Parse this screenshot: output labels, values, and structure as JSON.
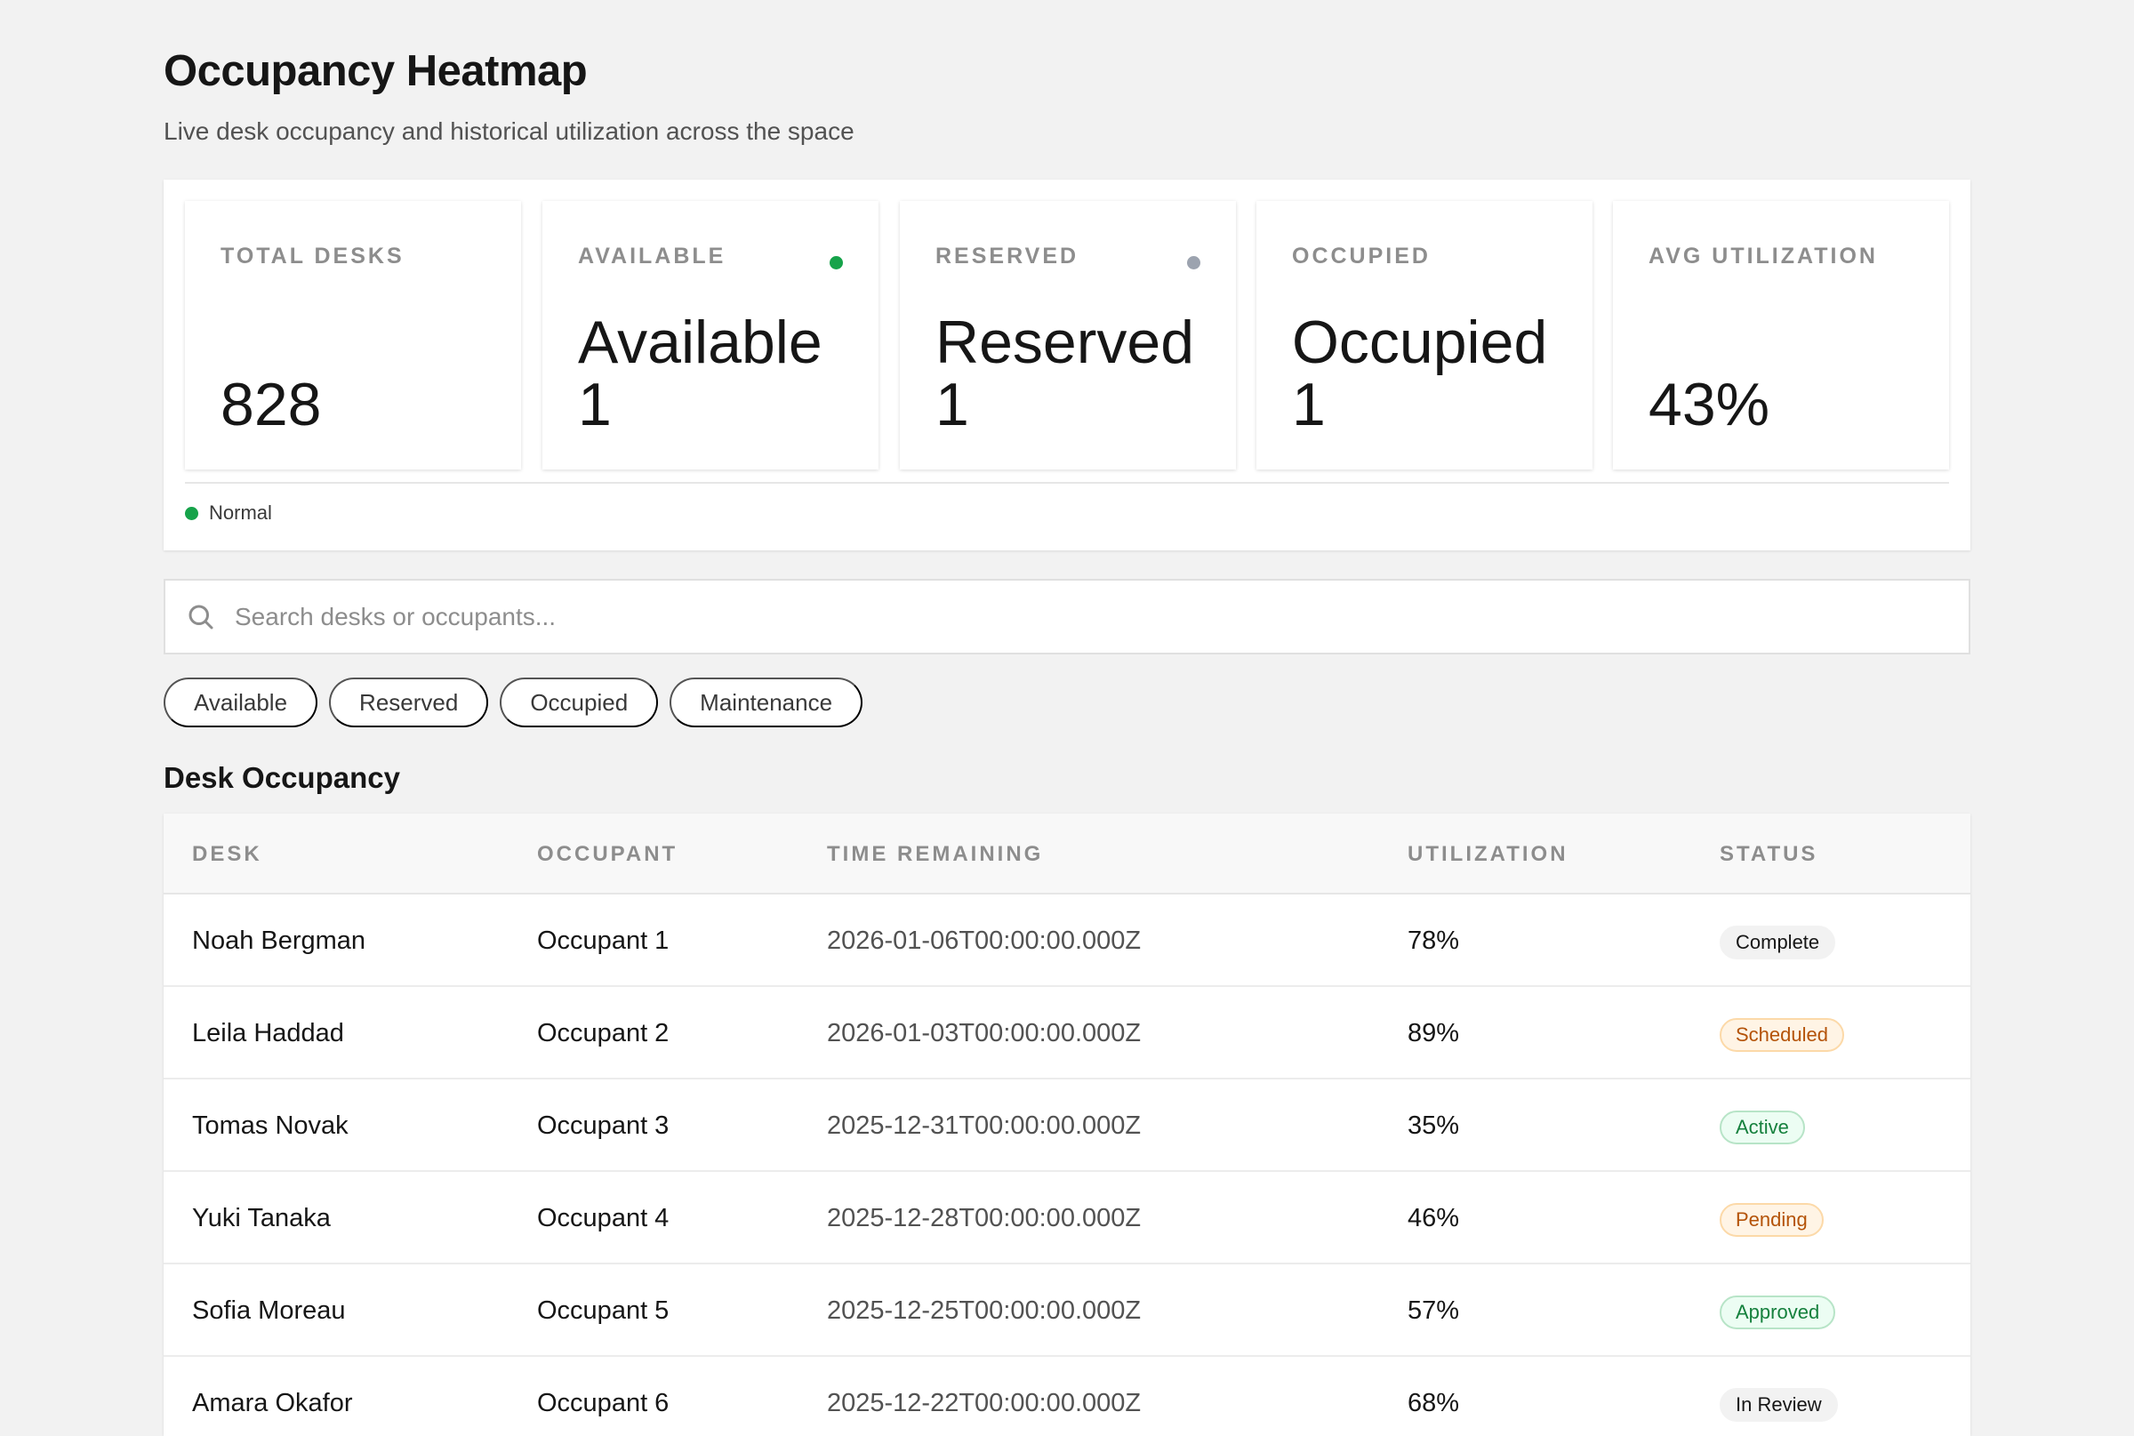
{
  "header": {
    "title": "Occupancy Heatmap",
    "subtitle": "Live desk occupancy and historical utilization across the space"
  },
  "stats": [
    {
      "label": "TOTAL DESKS",
      "value_top": "",
      "value_bottom": "828",
      "dot_color": ""
    },
    {
      "label": "AVAILABLE",
      "value_top": "Available",
      "value_bottom": "1",
      "dot_color": "#16a34a"
    },
    {
      "label": "RESERVED",
      "value_top": "Reserved",
      "value_bottom": "1",
      "dot_color": "#9ca3af"
    },
    {
      "label": "OCCUPIED",
      "value_top": "Occupied",
      "value_bottom": "1",
      "dot_color": ""
    },
    {
      "label": "AVG UTILIZATION",
      "value_top": "",
      "value_bottom": "43%",
      "dot_color": ""
    }
  ],
  "legend": {
    "label": "Normal",
    "dot_color": "#16a34a"
  },
  "search": {
    "placeholder": "Search desks or occupants...",
    "value": ""
  },
  "filters": [
    "Available",
    "Reserved",
    "Occupied",
    "Maintenance"
  ],
  "table": {
    "title": "Desk Occupancy",
    "columns": [
      "DESK",
      "OCCUPANT",
      "TIME REMAINING",
      "UTILIZATION",
      "STATUS"
    ],
    "rows": [
      {
        "desk": "Noah Bergman",
        "occupant": "Occupant 1",
        "time": "2026-01-06T00:00:00.000Z",
        "util": "78%",
        "status": "Complete",
        "badge": {
          "bg": "#f2f2f2",
          "fg": "#161616",
          "border": "#f2f2f2"
        }
      },
      {
        "desk": "Leila Haddad",
        "occupant": "Occupant 2",
        "time": "2026-01-03T00:00:00.000Z",
        "util": "89%",
        "status": "Scheduled",
        "badge": {
          "bg": "#fff4e5",
          "fg": "#b45309",
          "border": "#fcd9a8"
        }
      },
      {
        "desk": "Tomas Novak",
        "occupant": "Occupant 3",
        "time": "2025-12-31T00:00:00.000Z",
        "util": "35%",
        "status": "Active",
        "badge": {
          "bg": "#ecfdf3",
          "fg": "#15803d",
          "border": "#b7e4c7"
        }
      },
      {
        "desk": "Yuki Tanaka",
        "occupant": "Occupant 4",
        "time": "2025-12-28T00:00:00.000Z",
        "util": "46%",
        "status": "Pending",
        "badge": {
          "bg": "#fff4e5",
          "fg": "#b45309",
          "border": "#fcd9a8"
        }
      },
      {
        "desk": "Sofia Moreau",
        "occupant": "Occupant 5",
        "time": "2025-12-25T00:00:00.000Z",
        "util": "57%",
        "status": "Approved",
        "badge": {
          "bg": "#ecfdf3",
          "fg": "#15803d",
          "border": "#b7e4c7"
        }
      },
      {
        "desk": "Amara Okafor",
        "occupant": "Occupant 6",
        "time": "2025-12-22T00:00:00.000Z",
        "util": "68%",
        "status": "In Review",
        "badge": {
          "bg": "#f2f2f2",
          "fg": "#161616",
          "border": "#f2f2f2"
        }
      }
    ]
  }
}
